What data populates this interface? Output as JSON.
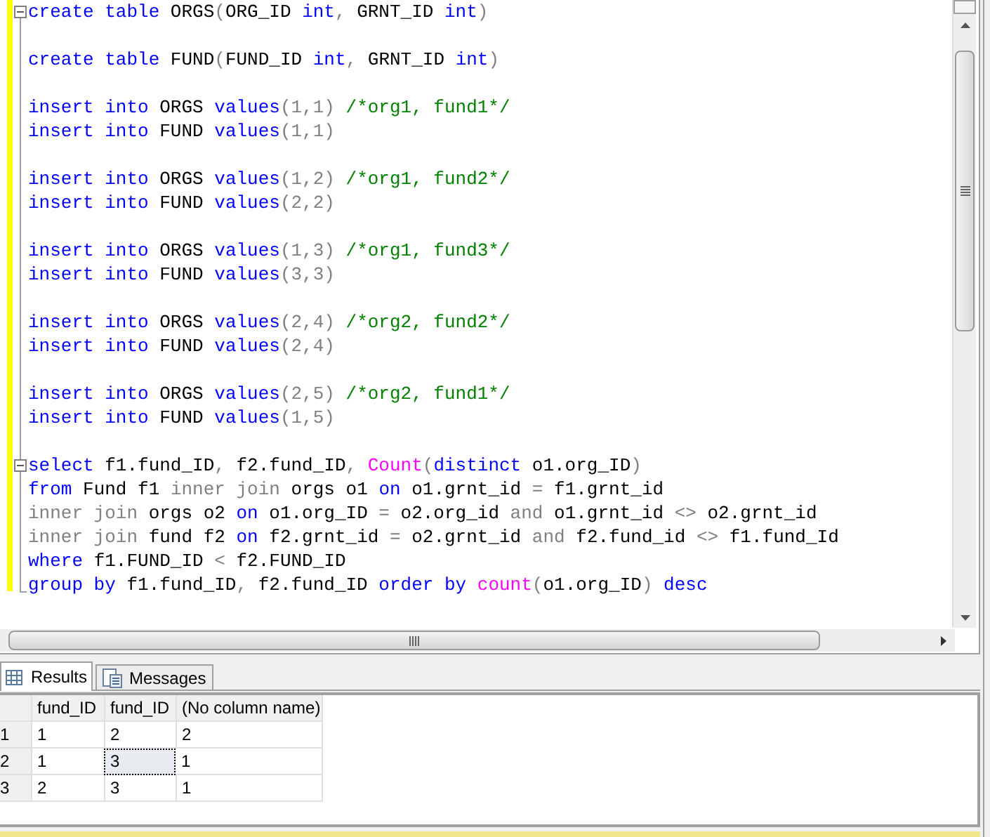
{
  "editor": {
    "blocks": [
      {
        "fold_start": true,
        "lines": [
          [
            {
              "kind": "keyword",
              "text": "create table "
            },
            {
              "kind": "plain",
              "text": "ORGS"
            },
            {
              "kind": "gray",
              "text": "("
            },
            {
              "kind": "plain",
              "text": "ORG_ID "
            },
            {
              "kind": "keyword",
              "text": "int"
            },
            {
              "kind": "gray",
              "text": ", "
            },
            {
              "kind": "plain",
              "text": "GRNT_ID "
            },
            {
              "kind": "keyword",
              "text": "int"
            },
            {
              "kind": "gray",
              "text": ")"
            }
          ]
        ]
      },
      {
        "fold_start": false,
        "lines": [
          [
            {
              "kind": "keyword",
              "text": "create table "
            },
            {
              "kind": "plain",
              "text": "FUND"
            },
            {
              "kind": "gray",
              "text": "("
            },
            {
              "kind": "plain",
              "text": "FUND_ID "
            },
            {
              "kind": "keyword",
              "text": "int"
            },
            {
              "kind": "gray",
              "text": ", "
            },
            {
              "kind": "plain",
              "text": "GRNT_ID "
            },
            {
              "kind": "keyword",
              "text": "int"
            },
            {
              "kind": "gray",
              "text": ")"
            }
          ]
        ]
      },
      {
        "fold_start": false,
        "lines": [
          [
            {
              "kind": "keyword",
              "text": "insert into "
            },
            {
              "kind": "plain",
              "text": "ORGS "
            },
            {
              "kind": "keyword",
              "text": "values"
            },
            {
              "kind": "gray",
              "text": "(1,1) "
            },
            {
              "kind": "comment",
              "text": "/*org1, fund1*/"
            }
          ],
          [
            {
              "kind": "keyword",
              "text": "insert into "
            },
            {
              "kind": "plain",
              "text": "FUND "
            },
            {
              "kind": "keyword",
              "text": "values"
            },
            {
              "kind": "gray",
              "text": "(1,1)"
            }
          ]
        ]
      },
      {
        "fold_start": false,
        "lines": [
          [
            {
              "kind": "keyword",
              "text": "insert into "
            },
            {
              "kind": "plain",
              "text": "ORGS "
            },
            {
              "kind": "keyword",
              "text": "values"
            },
            {
              "kind": "gray",
              "text": "(1,2) "
            },
            {
              "kind": "comment",
              "text": "/*org1, fund2*/"
            }
          ],
          [
            {
              "kind": "keyword",
              "text": "insert into "
            },
            {
              "kind": "plain",
              "text": "FUND "
            },
            {
              "kind": "keyword",
              "text": "values"
            },
            {
              "kind": "gray",
              "text": "(2,2)"
            }
          ]
        ]
      },
      {
        "fold_start": false,
        "lines": [
          [
            {
              "kind": "keyword",
              "text": "insert into "
            },
            {
              "kind": "plain",
              "text": "ORGS "
            },
            {
              "kind": "keyword",
              "text": "values"
            },
            {
              "kind": "gray",
              "text": "(1,3) "
            },
            {
              "kind": "comment",
              "text": "/*org1, fund3*/"
            }
          ],
          [
            {
              "kind": "keyword",
              "text": "insert into "
            },
            {
              "kind": "plain",
              "text": "FUND "
            },
            {
              "kind": "keyword",
              "text": "values"
            },
            {
              "kind": "gray",
              "text": "(3,3)"
            }
          ]
        ]
      },
      {
        "fold_start": false,
        "lines": [
          [
            {
              "kind": "keyword",
              "text": "insert into "
            },
            {
              "kind": "plain",
              "text": "ORGS "
            },
            {
              "kind": "keyword",
              "text": "values"
            },
            {
              "kind": "gray",
              "text": "(2,4) "
            },
            {
              "kind": "comment",
              "text": "/*org2, fund2*/"
            }
          ],
          [
            {
              "kind": "keyword",
              "text": "insert into "
            },
            {
              "kind": "plain",
              "text": "FUND "
            },
            {
              "kind": "keyword",
              "text": "values"
            },
            {
              "kind": "gray",
              "text": "(2,4)"
            }
          ]
        ]
      },
      {
        "fold_start": false,
        "lines": [
          [
            {
              "kind": "keyword",
              "text": "insert into "
            },
            {
              "kind": "plain",
              "text": "ORGS "
            },
            {
              "kind": "keyword",
              "text": "values"
            },
            {
              "kind": "gray",
              "text": "(2,5) "
            },
            {
              "kind": "comment",
              "text": "/*org2, fund1*/"
            }
          ],
          [
            {
              "kind": "keyword",
              "text": "insert into "
            },
            {
              "kind": "plain",
              "text": "FUND "
            },
            {
              "kind": "keyword",
              "text": "values"
            },
            {
              "kind": "gray",
              "text": "(1,5)"
            }
          ]
        ]
      },
      {
        "fold_start": true,
        "lines": [
          [
            {
              "kind": "keyword",
              "text": "select "
            },
            {
              "kind": "plain",
              "text": "f1.fund_ID"
            },
            {
              "kind": "gray",
              "text": ", "
            },
            {
              "kind": "plain",
              "text": "f2.fund_ID"
            },
            {
              "kind": "gray",
              "text": ", "
            },
            {
              "kind": "function",
              "text": "Count"
            },
            {
              "kind": "gray",
              "text": "("
            },
            {
              "kind": "keyword",
              "text": "distinct "
            },
            {
              "kind": "plain",
              "text": "o1.org_ID"
            },
            {
              "kind": "gray",
              "text": ")"
            }
          ],
          [
            {
              "kind": "keyword",
              "text": "from "
            },
            {
              "kind": "plain",
              "text": "Fund f1 "
            },
            {
              "kind": "gray",
              "text": "inner join "
            },
            {
              "kind": "plain",
              "text": "orgs o1 "
            },
            {
              "kind": "keyword",
              "text": "on "
            },
            {
              "kind": "plain",
              "text": "o1.grnt_id "
            },
            {
              "kind": "gray",
              "text": "= "
            },
            {
              "kind": "plain",
              "text": "f1.grnt_id"
            }
          ],
          [
            {
              "kind": "gray",
              "text": "inner join "
            },
            {
              "kind": "plain",
              "text": "orgs o2 "
            },
            {
              "kind": "keyword",
              "text": "on "
            },
            {
              "kind": "plain",
              "text": "o1.org_ID "
            },
            {
              "kind": "gray",
              "text": "= "
            },
            {
              "kind": "plain",
              "text": "o2.org_id "
            },
            {
              "kind": "gray",
              "text": "and "
            },
            {
              "kind": "plain",
              "text": "o1.grnt_id "
            },
            {
              "kind": "gray",
              "text": "<> "
            },
            {
              "kind": "plain",
              "text": "o2.grnt_id"
            }
          ],
          [
            {
              "kind": "gray",
              "text": "inner join "
            },
            {
              "kind": "plain",
              "text": "fund f2 "
            },
            {
              "kind": "keyword",
              "text": "on "
            },
            {
              "kind": "plain",
              "text": "f2.grnt_id "
            },
            {
              "kind": "gray",
              "text": "= "
            },
            {
              "kind": "plain",
              "text": "o2.grnt_id "
            },
            {
              "kind": "gray",
              "text": "and "
            },
            {
              "kind": "plain",
              "text": "f2.fund_id "
            },
            {
              "kind": "gray",
              "text": "<> "
            },
            {
              "kind": "plain",
              "text": "f1.fund_Id"
            }
          ],
          [
            {
              "kind": "keyword",
              "text": "where "
            },
            {
              "kind": "plain",
              "text": "f1.FUND_ID "
            },
            {
              "kind": "gray",
              "text": "< "
            },
            {
              "kind": "plain",
              "text": "f2.FUND_ID"
            }
          ],
          [
            {
              "kind": "keyword",
              "text": "group by "
            },
            {
              "kind": "plain",
              "text": "f1.fund_ID"
            },
            {
              "kind": "gray",
              "text": ", "
            },
            {
              "kind": "plain",
              "text": "f2.fund_ID "
            },
            {
              "kind": "keyword",
              "text": "order by "
            },
            {
              "kind": "function",
              "text": "count"
            },
            {
              "kind": "gray",
              "text": "("
            },
            {
              "kind": "plain",
              "text": "o1.org_ID"
            },
            {
              "kind": "gray",
              "text": ") "
            },
            {
              "kind": "keyword",
              "text": "desc"
            }
          ]
        ]
      }
    ]
  },
  "tabs": [
    {
      "label": "Results",
      "selected": true
    },
    {
      "label": "Messages",
      "selected": false
    }
  ],
  "grid": {
    "columns": [
      "fund_ID",
      "fund_ID",
      "(No column name)"
    ],
    "rows": [
      {
        "number": "1",
        "cells": [
          {
            "text": "1",
            "focused": false
          },
          {
            "text": "2",
            "focused": false
          },
          {
            "text": "2",
            "focused": false
          }
        ]
      },
      {
        "number": "2",
        "cells": [
          {
            "text": "1",
            "focused": false
          },
          {
            "text": "3",
            "focused": true
          },
          {
            "text": "1",
            "focused": false
          }
        ]
      },
      {
        "number": "3",
        "cells": [
          {
            "text": "2",
            "focused": false
          },
          {
            "text": "3",
            "focused": false
          },
          {
            "text": "1",
            "focused": false
          }
        ]
      }
    ]
  }
}
